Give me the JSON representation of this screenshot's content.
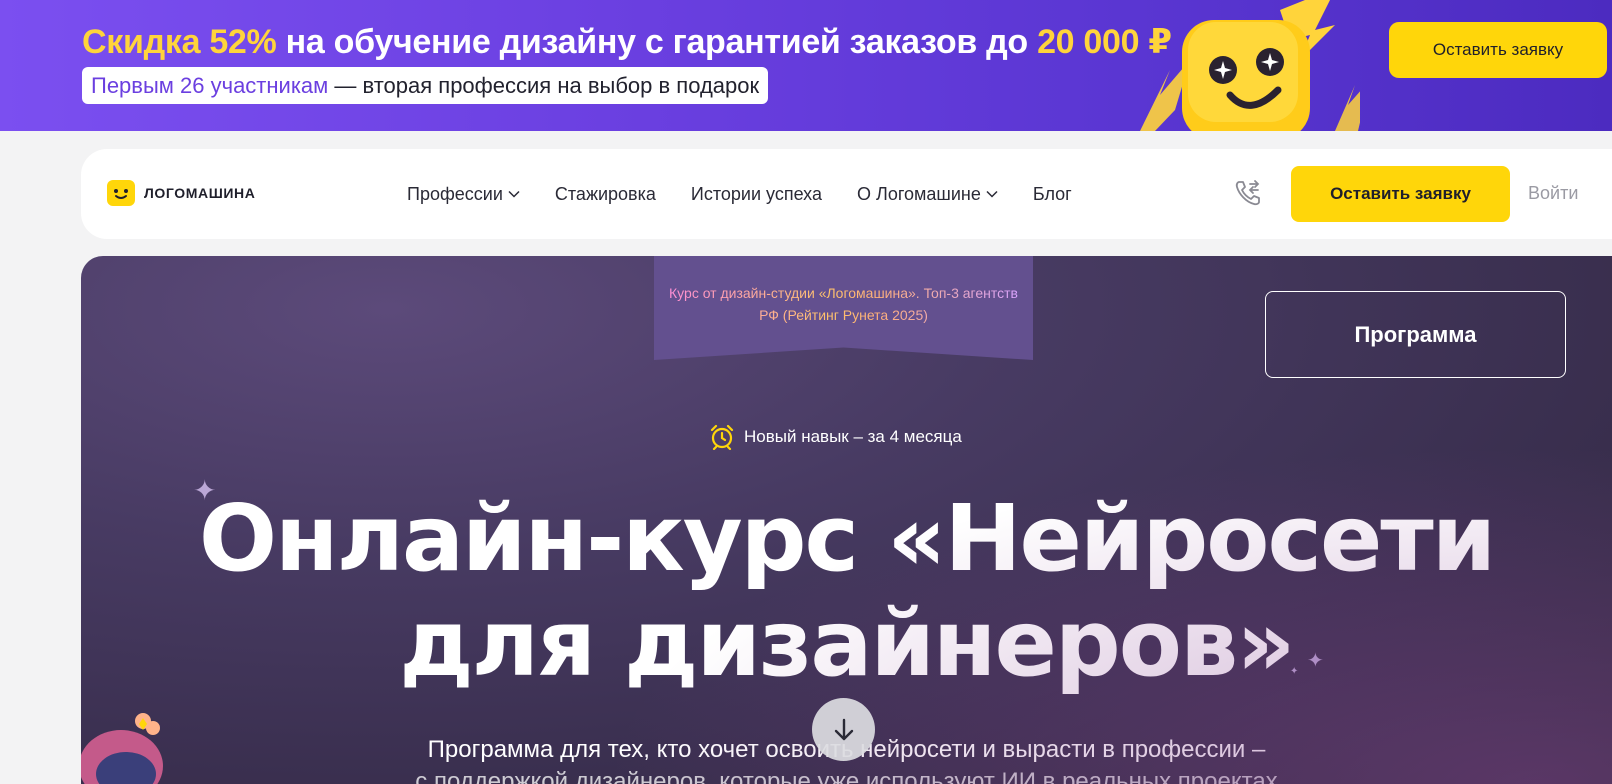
{
  "promo": {
    "title_prefix_highlight": "Скидка 52%",
    "title_middle": " на обучение дизайну с гарантией заказов до ",
    "title_amount": "20 000 ₽",
    "sub_highlight": "Первым 26 участникам",
    "sub_rest": " — вторая профессия на выбор в подарок",
    "button_label": "Оставить заявку"
  },
  "header": {
    "logo_text": "ЛОГОМАШИНА",
    "menu": [
      {
        "label": "Профессии",
        "has_dropdown": true
      },
      {
        "label": "Стажировка",
        "has_dropdown": false
      },
      {
        "label": "Истории успеха",
        "has_dropdown": false
      },
      {
        "label": "О Логомашине",
        "has_dropdown": true
      },
      {
        "label": "Блог",
        "has_dropdown": false
      }
    ],
    "cta_label": "Оставить заявку",
    "login_label": "Войти",
    "phone_icon": "phone-callback-icon"
  },
  "hero": {
    "ribbon_text": "Курс от дизайн-студии «Логомашина». Топ-3 агентств РФ (Рейтинг Рунета 2025)",
    "program_button": "Программа",
    "duration_text": "Новый навык – за 4 месяца",
    "duration_icon": "alarm-clock-icon",
    "headline_line1": "Онлайн-курс «Нейросети",
    "headline_line2": "для дизайнеров»",
    "subtitle_line1": "Программа для тех, кто хочет освоить нейросети и вырасти в профессии –",
    "subtitle_line2": "с поддержкой дизайнеров, которые уже используют ИИ в реальных проектах",
    "scroll_icon": "arrow-down-icon"
  },
  "colors": {
    "accent_yellow": "#ffd60a",
    "promo_purple": "#6a3fe0",
    "hero_bg": "#483b63"
  }
}
